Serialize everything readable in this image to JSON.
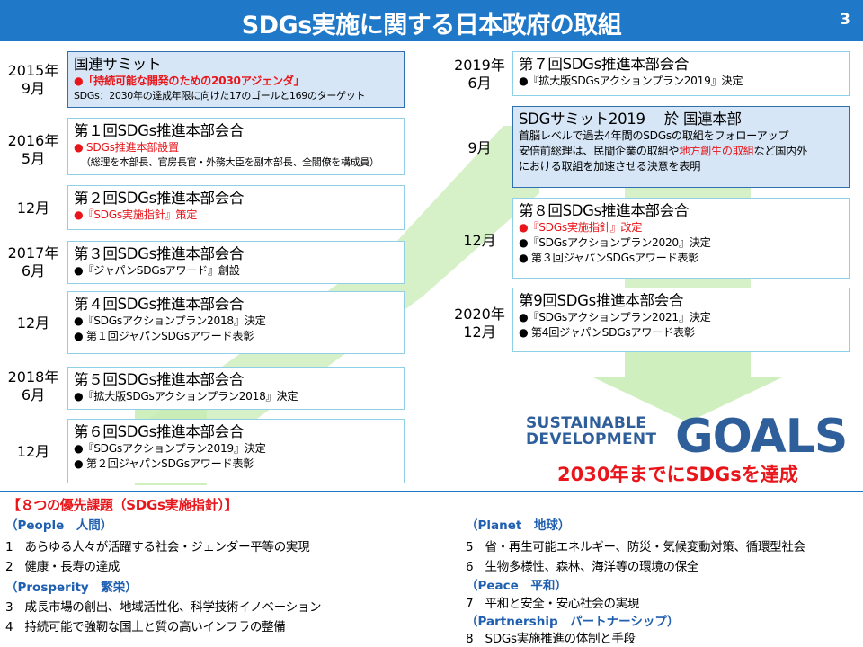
{
  "header": {
    "title": "SDGs実施に関する日本政府の取組",
    "page_number": "3"
  },
  "left_timeline": [
    {
      "date": [
        "2015年",
        "9月"
      ],
      "title": "国連サミット",
      "highlight": true,
      "lines": [
        {
          "text": "●「持続可能な開発のための2030アジェンダ」",
          "style": "red bold"
        },
        {
          "text": "SDGs：2030年の達成年限に向けた17のゴールと169のターゲット",
          "style": "sm"
        }
      ]
    },
    {
      "date": [
        "2016年",
        "5月"
      ],
      "title": "第１回SDGs推進本部会合",
      "lines": [
        {
          "text": "● SDGs推進本部設置",
          "style": "red"
        },
        {
          "text": "（総理を本部長、官房長官・外務大臣を副本部長、全閣僚を構成員）",
          "style": "sub"
        }
      ]
    },
    {
      "date": [
        "12月"
      ],
      "title": "第２回SDGs推進本部会合",
      "lines": [
        {
          "text": "●『SDGs実施指針』策定",
          "style": "red"
        }
      ]
    },
    {
      "date": [
        "2017年",
        "6月"
      ],
      "title": "第３回SDGs推進本部会合",
      "lines": [
        {
          "text": "●『ジャパンSDGsアワード』創設",
          "style": ""
        }
      ]
    },
    {
      "date": [
        "12月"
      ],
      "title": "第４回SDGs推進本部会合",
      "lines": [
        {
          "text": "●『SDGsアクションプラン2018』決定",
          "style": ""
        },
        {
          "text": "● 第１回ジャパンSDGsアワード表彰",
          "style": ""
        }
      ]
    },
    {
      "date": [
        "2018年",
        "6月"
      ],
      "title": "第５回SDGs推進本部会合",
      "lines": [
        {
          "text": "●『拡大版SDGsアクションプラン2018』決定",
          "style": ""
        }
      ]
    },
    {
      "date": [
        "12月"
      ],
      "title": "第６回SDGs推進本部会合",
      "lines": [
        {
          "text": "●『SDGsアクションプラン2019』決定",
          "style": ""
        },
        {
          "text": "● 第２回ジャパンSDGsアワード表彰",
          "style": ""
        }
      ]
    }
  ],
  "right_timeline": [
    {
      "date": [
        "2019年",
        "6月"
      ],
      "title": "第７回SDGs推進本部会合",
      "lines": [
        {
          "text": "●『拡大版SDGsアクションプラン2019』決定",
          "style": ""
        }
      ]
    },
    {
      "date": [
        "9月"
      ],
      "title": "SDGサミット2019　 於 国連本部",
      "highlight": true,
      "lines": [
        {
          "text": "首脳レベルで過去4年間のSDGsの取組をフォローアップ",
          "style": ""
        },
        {
          "text_parts": [
            "安倍前総理は、民間企業の取組や",
            "地方創生の取組",
            "など国内外"
          ],
          "style": ""
        },
        {
          "text": "における取組を加速させる決意を表明",
          "style": ""
        }
      ]
    },
    {
      "date": [
        "12月"
      ],
      "title": "第８回SDGs推進本部会合",
      "lines": [
        {
          "text": "●『SDGs実施指針』改定",
          "style": "red"
        },
        {
          "text": "●『SDGsアクションプラン2020』決定",
          "style": ""
        },
        {
          "text": "● 第３回ジャパンSDGsアワード表彰",
          "style": ""
        }
      ]
    },
    {
      "date": [
        "2020年",
        "12月"
      ],
      "title": "第9回SDGs推進本部会合",
      "lines": [
        {
          "text": "●『SDGsアクションプラン2021』決定",
          "style": ""
        },
        {
          "text": "● 第4回ジャパンSDGsアワード表彰",
          "style": ""
        }
      ]
    }
  ],
  "sdg_logo": {
    "line1": "SUSTAINABLE",
    "line2": "DEVELOPMENT",
    "goals": "GOALS"
  },
  "goal_caption": "2030年までにSDGsを達成",
  "priorities": {
    "heading": "【８つの優先課題（SDGs実施指針）】",
    "people": {
      "label": "（People　人間）",
      "items": [
        "1　あらゆる人々が活躍する社会・ジェンダー平等の実現",
        "2　健康・長寿の達成"
      ]
    },
    "prosperity": {
      "label": "（Prosperity　繁栄）",
      "items": [
        "3　成長市場の創出、地域活性化、科学技術イノベーション",
        "4　持続可能で強靭な国土と質の高いインフラの整備"
      ]
    },
    "planet": {
      "label": "（Planet　地球）",
      "items": [
        "5　省・再生可能エネルギー、防災・気候変動対策、循環型社会",
        "6　生物多様性、森林、海洋等の環境の保全"
      ]
    },
    "peace": {
      "label": "（Peace　平和）",
      "items": [
        "7　平和と安全・安心社会の実現"
      ]
    },
    "partnership": {
      "label": "（Partnership　パートナーシップ）",
      "items": [
        "8　SDGs実施推進の体制と手段"
      ]
    }
  },
  "colors": {
    "accent_blue": "#1f78c8",
    "red": "#e8161b",
    "arrow_green": "#c8ecb4"
  }
}
